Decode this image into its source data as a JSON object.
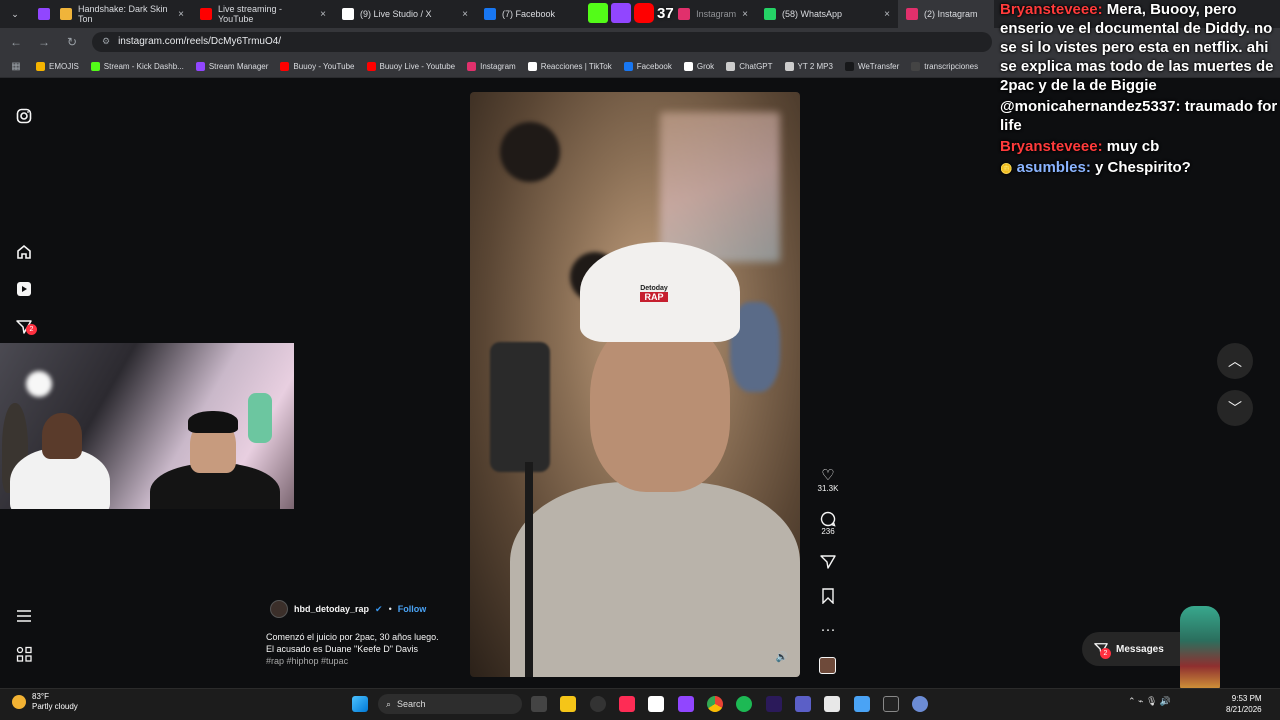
{
  "browser": {
    "tabs": [
      {
        "label": "Handshake: Dark Skin Ton",
        "color": "#f0b43a"
      },
      {
        "label": "Live streaming - YouTube",
        "color": "#ff0000"
      },
      {
        "label": "(9) Live Studio / X",
        "color": "#ffffff"
      },
      {
        "label": "(7) Facebook",
        "color": "#1877f2"
      },
      {
        "label": "Instagram",
        "color": "#e1306c"
      },
      {
        "label": "(58) WhatsApp",
        "color": "#25d366"
      },
      {
        "label": "(2) Instagram",
        "color": "#e1306c"
      }
    ],
    "close_glyph": "×",
    "url": "instagram.com/reels/DcMy6TrmuO4/",
    "bookmarks": [
      {
        "label": "EMOJIS",
        "color": "#f5b400"
      },
      {
        "label": "Stream - Kick Dashb...",
        "color": "#53fc18"
      },
      {
        "label": "Stream Manager",
        "color": "#9146ff"
      },
      {
        "label": "Buuoy - YouTube",
        "color": "#ff0000"
      },
      {
        "label": "Buuoy Live - Youtube",
        "color": "#ff0000"
      },
      {
        "label": "Instagram",
        "color": "#e1306c"
      },
      {
        "label": "Reacciones | TikTok",
        "color": "#ffffff"
      },
      {
        "label": "Facebook",
        "color": "#1877f2"
      },
      {
        "label": "Grok",
        "color": "#ffffff"
      },
      {
        "label": "ChatGPT",
        "color": "#cccccc"
      },
      {
        "label": "YT 2 MP3",
        "color": "#cccccc"
      },
      {
        "label": "WeTransfer",
        "color": "#17181a"
      },
      {
        "label": "transcripciones",
        "color": "#444444"
      }
    ]
  },
  "instagram": {
    "nav_badge": "2",
    "reel": {
      "author": "hbd_detoday_rap",
      "follow_label": "Follow",
      "caption_line1": "Comenzó el juicio por 2pac, 30 años luego.",
      "caption_line2": "El acusado es Duane \"Keefe D\" Davis",
      "hashtags": "#rap #hiphop #tupac",
      "cap_brand": "Detoday",
      "cap_rap": "RAP",
      "likes": "31.3K",
      "comments": "236"
    },
    "messages_label": "Messages",
    "messages_badge": "2"
  },
  "chat": [
    {
      "user": "Bryansteveee:",
      "user_color": "red",
      "text": " Mera, Buooy, pero enserio ve el documental de Diddy. no se si lo vistes pero esta en netflix. ahi se explica mas todo de las muertes de 2pac y de la de Biggie"
    },
    {
      "user": "",
      "user_color": "",
      "text": "@monicahernandez5337: traumado for life"
    },
    {
      "user": "Bryansteveee:",
      "user_color": "red",
      "text": " muy cb"
    },
    {
      "user": "asumbles:",
      "user_color": "blue",
      "text": " y Chespirito?"
    }
  ],
  "twitch_overlay": {
    "viewers": "37"
  },
  "taskbar": {
    "temperature": "83°F",
    "weather": "Partly cloudy",
    "search_label": "Search",
    "time": "9:53 PM",
    "date": "8/21/2026"
  }
}
